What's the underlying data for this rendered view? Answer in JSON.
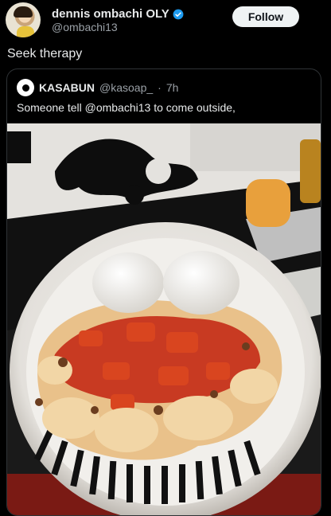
{
  "author": {
    "display_name": "dennis ombachi OLY",
    "handle": "@ombachi13",
    "verified": true
  },
  "follow_button": "Follow",
  "tweet_text": "Seek therapy",
  "quoted": {
    "display_name": "KASABUN",
    "handle": "@kasoap_",
    "separator": "·",
    "time": "7h",
    "text": "Someone tell @ombachi13 to come outside,"
  },
  "colors": {
    "background": "#000000",
    "text": "#e7e9ea",
    "muted": "#9aa0a6",
    "verified": "#1d9bf0",
    "follow_bg": "#eff3f4"
  }
}
